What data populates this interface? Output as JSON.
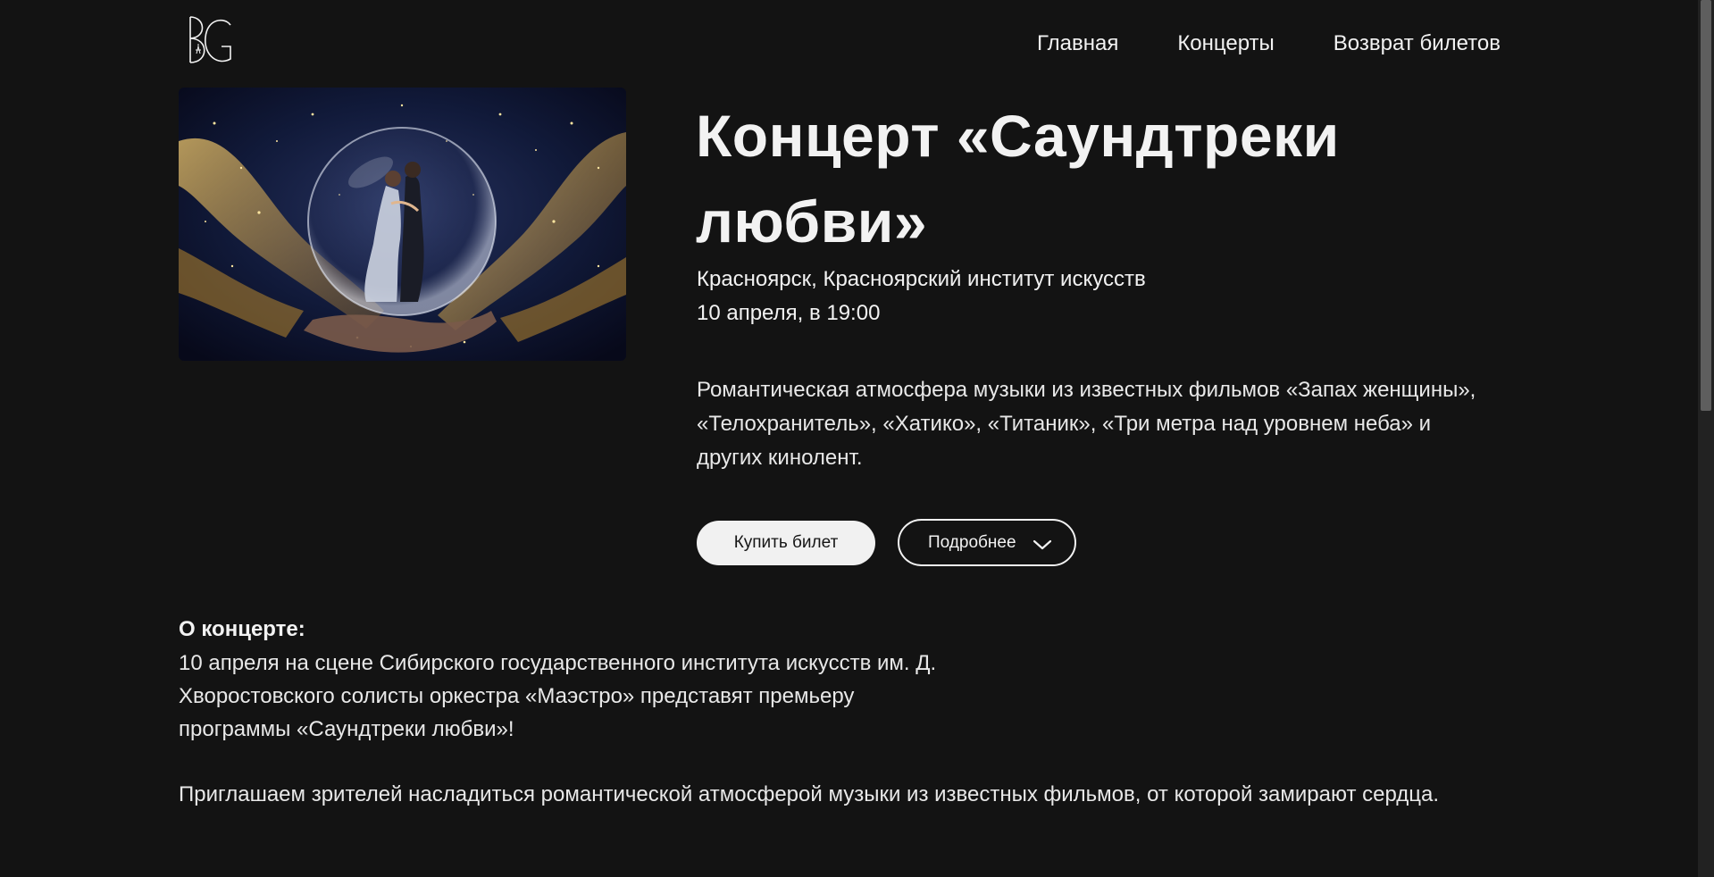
{
  "header": {
    "logo_text": "BG",
    "nav": [
      "Главная",
      "Концерты",
      "Возврат билетов"
    ]
  },
  "concert": {
    "title": "Концерт «Саундтреки любви»",
    "location": "Красноярск, Красноярский институт искусств",
    "datetime": "10 апреля, в 19:00",
    "lead": "Романтическая атмосфера музыки из известных фильмов «Запах женщины», «Телохранитель», «Хатико», «Титаник», «Три метра над уровнем неба» и других кинолент.",
    "buy_label": "Купить билет",
    "more_label": "Подробнее"
  },
  "about": {
    "heading": "О концерте:",
    "text": "10 апреля на сцене Сибирского государственного института искусств им. Д. Хворостовского солисты оркестра «Маэстро» представят премьеру программы «Саундтреки любви»!",
    "invite": "Приглашаем зрителей насладиться романтической атмосферой музыки из известных фильмов, от которой замирают сердца."
  },
  "colors": {
    "background": "#131313",
    "text": "#f2f2f2",
    "button_fill": "#f1f1f1",
    "gold": "#c9a44c"
  }
}
